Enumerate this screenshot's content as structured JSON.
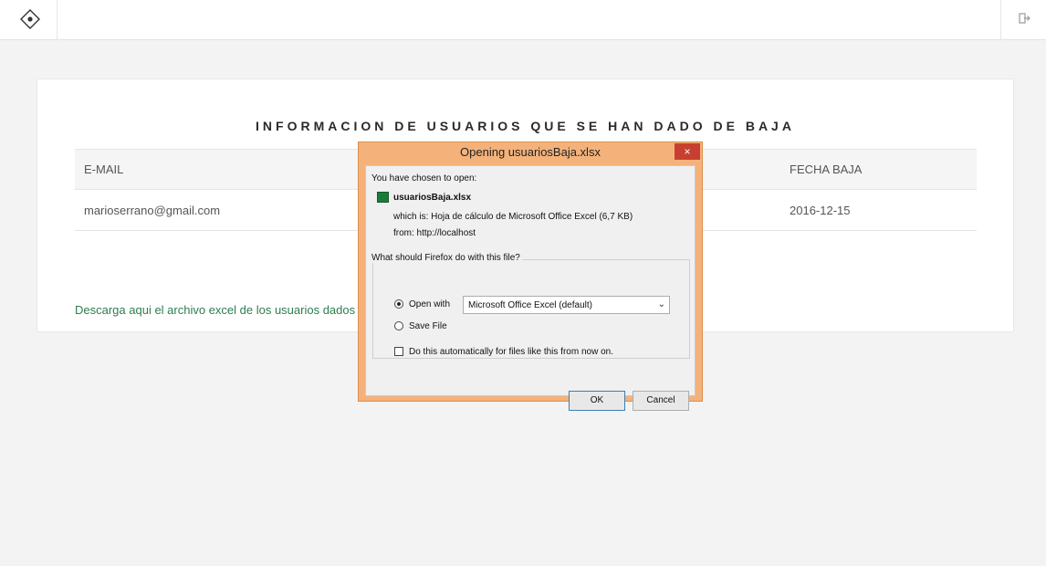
{
  "header": {
    "logo_icon": "diamond-dot-icon",
    "logout_icon": "sign-out-icon"
  },
  "main": {
    "title": "INFORMACION DE USUARIOS QUE SE HAN DADO DE BAJA",
    "columns": [
      "E-MAIL",
      "FECHA BAJA"
    ],
    "rows": [
      {
        "email": "marioserrano@gmail.com",
        "fecha_baja": "2016-12-15"
      }
    ],
    "download_text": "Descarga aqui el archivo excel de los usuarios dados de"
  },
  "dialog": {
    "title": "Opening usuariosBaja.xlsx",
    "close_label": "×",
    "chosen_label": "You have chosen to open:",
    "file_name": "usuariosBaja.xlsx",
    "which_is": "which is:  Hoja de cálculo de Microsoft Office Excel (6,7 KB)",
    "from": "from:  http://localhost",
    "question": "What should Firefox do with this file?",
    "open_with_label": "Open with",
    "open_with_value": "Microsoft Office Excel (default)",
    "save_file_label": "Save File",
    "auto_label": "Do this automatically for files like this from now on.",
    "ok_label": "OK",
    "cancel_label": "Cancel"
  }
}
